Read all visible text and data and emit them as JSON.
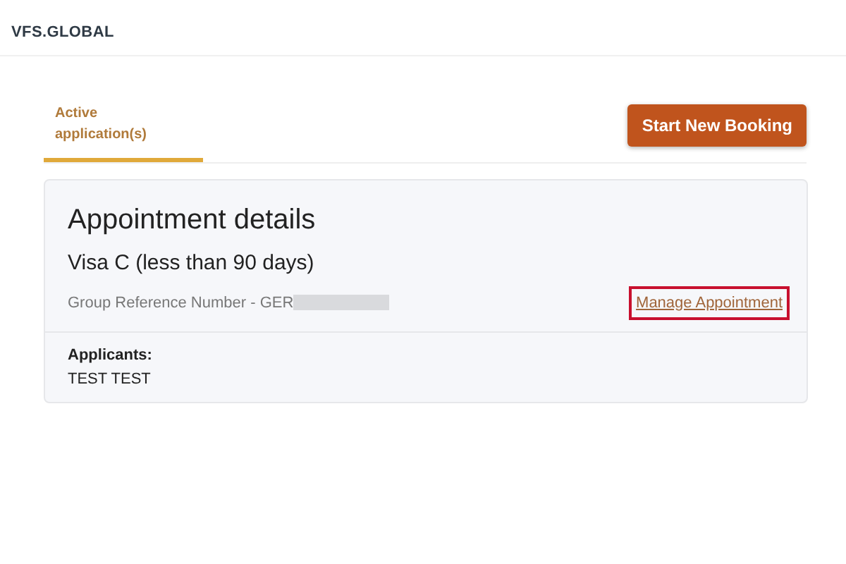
{
  "header": {
    "logo": "VFS.GLOBAL"
  },
  "tabs": [
    {
      "label": "Active application(s)",
      "selected": true
    }
  ],
  "actions": {
    "primary_button": "Start New Booking"
  },
  "appointment": {
    "title": "Appointment details",
    "visa_type": "Visa C (less than 90 days)",
    "reference_label": "Group Reference Number - GER",
    "reference_redacted": true,
    "manage_link": "Manage Appointment",
    "manage_highlighted": true,
    "applicants_label": "Applicants:",
    "applicants": [
      "TEST TEST"
    ]
  }
}
